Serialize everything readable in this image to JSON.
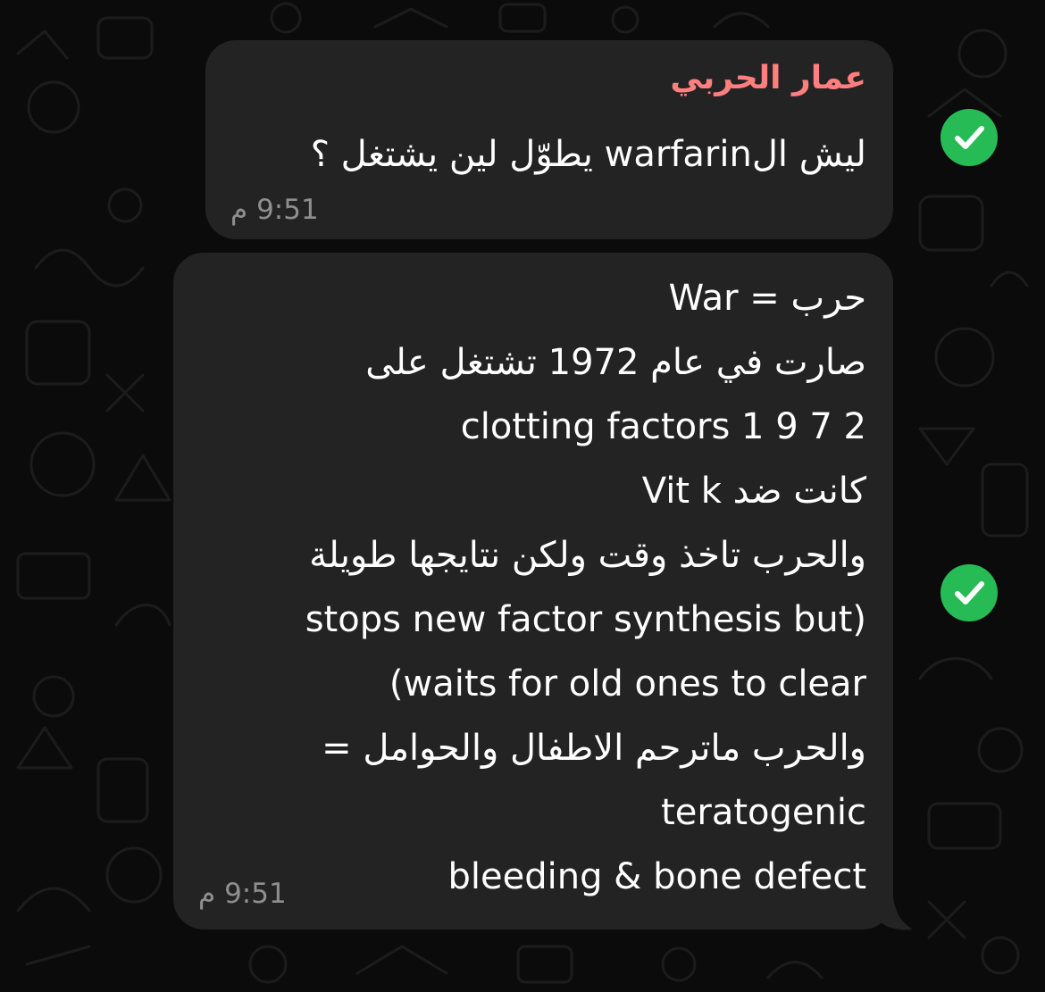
{
  "colors": {
    "background": "#0b0b0b",
    "bubble": "#232323",
    "sender_name": "#ff7e7e",
    "text": "#ffffff",
    "timestamp": "#8f8f8f",
    "read_check": "#27bb55"
  },
  "messages": [
    {
      "sender": "عمار الحربي",
      "lines": [
        "ليش الwarfarin يطوّل لين يشتغل ؟"
      ],
      "time": "9:51 م",
      "status_icon": "check-circle-icon"
    },
    {
      "lines": [
        "حرب = War",
        "صارت في عام 1972 تشتغل على",
        "clotting factors 1 9 7 2",
        "كانت ضد Vit k",
        "والحرب تاخذ وقت ولكن نتايجها طويلة",
        "stops new factor synthesis but)",
        "(waits for old ones to clear",
        "والحرب ماترحم الاطفال والحوامل =",
        "teratogenic",
        "bleeding & bone defect"
      ],
      "time": "9:51 م",
      "status_icon": "check-circle-icon"
    }
  ]
}
